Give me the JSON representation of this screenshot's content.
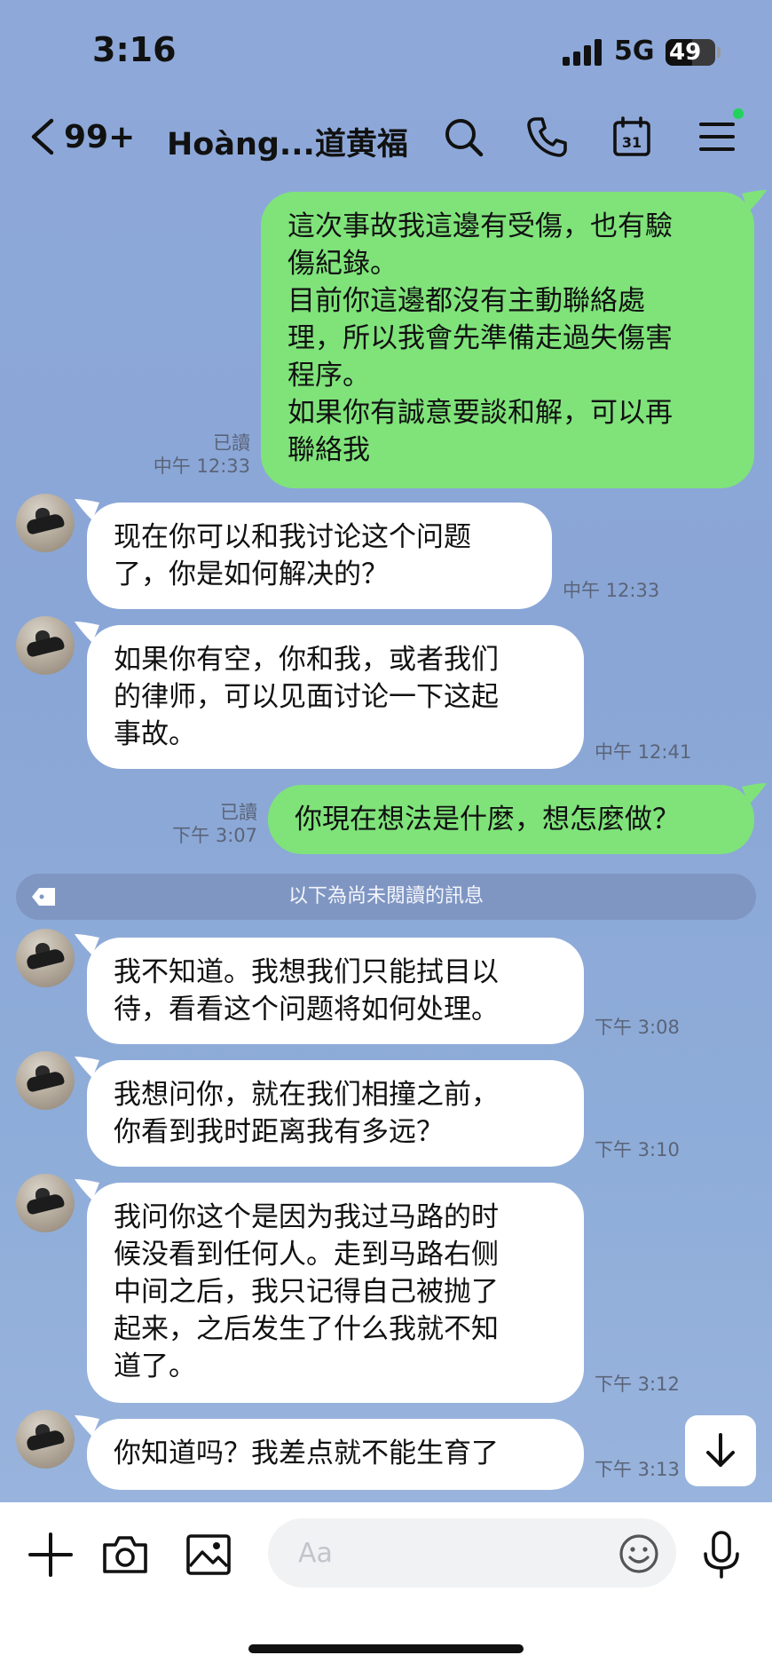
{
  "status_bar": {
    "time": "3:16",
    "network": "5G",
    "battery": "49"
  },
  "header": {
    "unread_count": "99+",
    "title": "Hoàng...道黄福"
  },
  "messages": [
    {
      "direction": "out",
      "lines": [
        "這次事故我這邊有受傷，也有驗",
        "傷紀錄。",
        "目前你這邊都沒有主動聯絡處",
        "理，所以我會先準備走過失傷害",
        "程序。",
        "如果你有誠意要談和解，可以再",
        "聯絡我"
      ],
      "read": "已讀",
      "time": "中午 12:33"
    },
    {
      "direction": "in",
      "lines": [
        "现在你可以和我讨论这个问题",
        "了，你是如何解决的？"
      ],
      "time": "中午 12:33"
    },
    {
      "direction": "in",
      "lines": [
        "如果你有空，你和我，或者我们",
        "的律师，可以见面讨论一下这起",
        "事故。"
      ],
      "time": "中午 12:41"
    },
    {
      "direction": "out",
      "lines": [
        "你現在想法是什麼，想怎麼做？"
      ],
      "read": "已讀",
      "time": "下午 3:07"
    },
    {
      "direction": "in",
      "lines": [
        "我不知道。我想我们只能拭目以",
        "待，看看这个问题将如何处理。"
      ],
      "time": "下午 3:08"
    },
    {
      "direction": "in",
      "lines": [
        "我想问你，就在我们相撞之前，",
        "你看到我时距离我有多远？"
      ],
      "time": "下午 3:10"
    },
    {
      "direction": "in",
      "lines": [
        "我问你这个是因为我过马路的时",
        "候没看到任何人。走到马路右侧",
        "中间之后，我只记得自己被抛了",
        "起来，之后发生了什么我就不知",
        "道了。"
      ],
      "time": "下午 3:12"
    },
    {
      "direction": "in",
      "lines": [
        "你知道吗？我差点就不能生育了"
      ],
      "time": "下午 3:13"
    }
  ],
  "unread_divider": "以下為尚未閱讀的訊息",
  "input": {
    "placeholder": "Aa"
  },
  "colors": {
    "outgoing_bubble": "#7fe37a",
    "incoming_bubble": "#ffffff",
    "background": "#8ea9d9",
    "online": "#22d35b"
  },
  "icons": [
    "back-icon",
    "search-icon",
    "phone-icon",
    "calendar-icon",
    "menu-icon",
    "plus-icon",
    "camera-icon",
    "image-icon",
    "emoji-icon",
    "microphone-icon",
    "arrow-down-icon",
    "tag-icon"
  ]
}
